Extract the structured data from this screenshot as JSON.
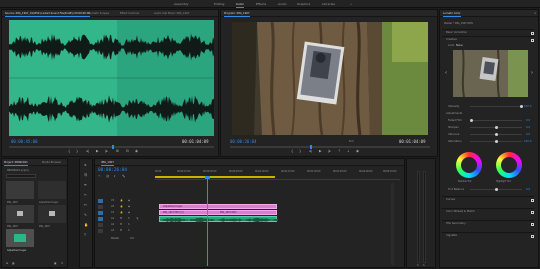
{
  "workspaces": [
    {
      "label": "Assembly",
      "active": false
    },
    {
      "label": "Editing",
      "active": false
    },
    {
      "label": "Color",
      "active": true
    },
    {
      "label": "Effects",
      "active": false
    },
    {
      "label": "Audio",
      "active": false
    },
    {
      "label": "Graphics",
      "active": false
    },
    {
      "label": "Libraries",
      "active": false
    },
    {
      "label": "»",
      "active": false
    }
  ],
  "source_panel": {
    "tabs": [
      {
        "label": "Source: IMG_1907_01/#59 (Linked Sound File(Draft)) 00:00:00:00",
        "active": true
      },
      {
        "label": "Lumetri Scopes",
        "active": false
      },
      {
        "label": "Effect Controls",
        "active": false
      },
      {
        "label": "Audio Clip Mixer: IMG_1907",
        "active": false
      }
    ],
    "timecode_left": "00:00:45:00",
    "timecode_right": "00:01:04:09"
  },
  "program_panel": {
    "tabs": [
      {
        "label": "Program: IMG_1907",
        "active": true
      }
    ],
    "timecode_left": "00:00:26:04",
    "fit_label": "Full",
    "timecode_right": "00:01:04:09"
  },
  "project_panel": {
    "tabs": [
      {
        "label": "Project: 08092021",
        "active": true
      },
      {
        "label": "Media Browser",
        "active": false
      }
    ],
    "filename": "08092021.prproj",
    "items": [
      {
        "name": "IMG_1907",
        "duration": "1:04:09"
      },
      {
        "name": "Adjustment Layer",
        "duration": "5:00"
      },
      {
        "name": "IMG_1907",
        "duration": "1:04:09"
      },
      {
        "name": "IMG_1907",
        "duration": "1:04:09"
      },
      {
        "name": "Adjustment Layer",
        "duration": "5:00"
      }
    ]
  },
  "timeline": {
    "tab": "IMG_1907",
    "timecode": "00:00:26:04",
    "ruler": [
      "00:00",
      "00:00:15:00",
      "00:00:30:00",
      "00:00:45:00",
      "00:01:00:00",
      "00:01:15:00",
      "00:01:30:00",
      "00:01:45:00",
      "00:02:00:00",
      "00:02:15:00"
    ],
    "tracks": [
      "V3",
      "V2",
      "V1",
      "A1",
      "A2",
      "A3",
      "Master"
    ],
    "master_value": "0.0",
    "clips": {
      "adjustment": "Adjustment Layer",
      "video": "IMG_1907.MOV [V]",
      "video2": "IMG_1907.MOV"
    }
  },
  "lumetri": {
    "tab": "Lumetri Color",
    "master": "Master * IMG_1907.MOV",
    "clip": "IMG_1907 * IMG_1907.MOV",
    "sections": {
      "basic": "Basic Correction",
      "creative": "Creative",
      "curves": "Curves",
      "color_wheels": "Color Wheels & Match",
      "hsl": "HSL Secondary",
      "vignette": "Vignette"
    },
    "look_label": "Look",
    "look_value": "None",
    "intensity_label": "Intensity",
    "intensity_value": "100.0",
    "adjustments_label": "Adjustments",
    "faded_film_label": "Faded Film",
    "faded_film_value": "0.0",
    "sharpen_label": "Sharpen",
    "sharpen_value": "0.0",
    "vibrance_label": "Vibrance",
    "vibrance_value": "0.0",
    "saturation_label": "Saturation",
    "saturation_value": "100.0",
    "shadow_tint_label": "Shadow Tint",
    "highlight_tint_label": "Highlight Tint",
    "tint_balance_label": "Tint Balance",
    "tint_balance_value": "0.0"
  }
}
